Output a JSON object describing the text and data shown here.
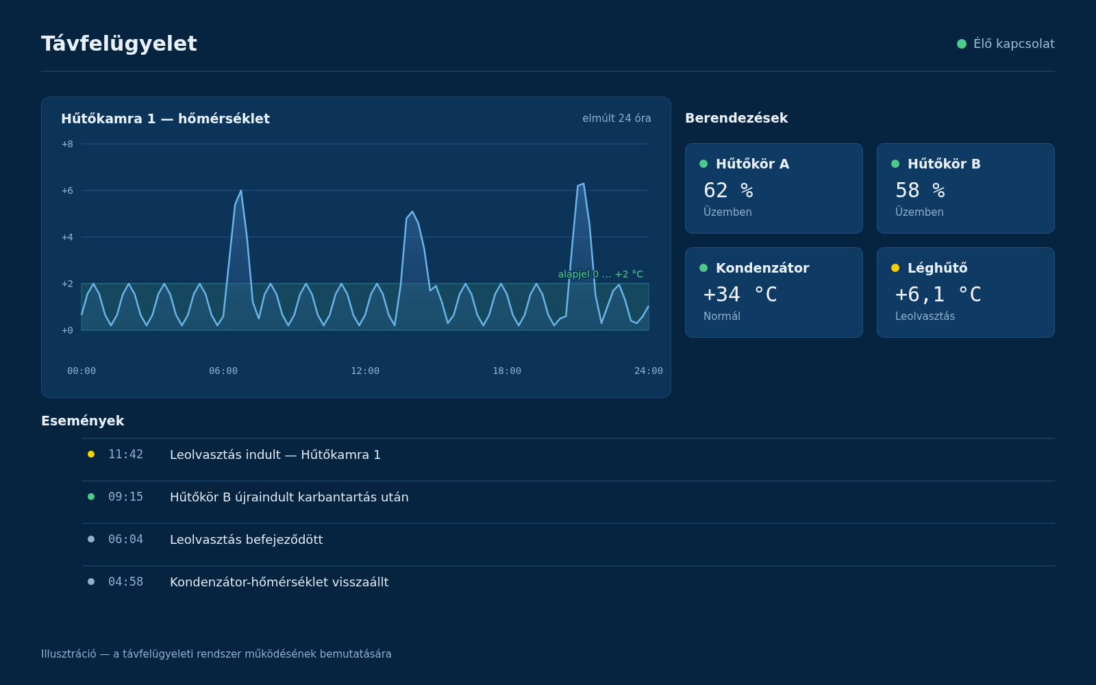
{
  "header": {
    "title": "Távfelügyelet",
    "status": {
      "label": "Élő kapcsolat",
      "color": "#4fc98a"
    }
  },
  "chart_panel": {
    "title": "Hűtőkamra 1 — hőmérséklet",
    "range": "elmúlt 24 óra",
    "chart_data": {
      "type": "area",
      "grid": true,
      "xlim": [
        0,
        24
      ],
      "ylim": [
        0,
        8
      ],
      "x": [
        0,
        0.25,
        0.5,
        0.75,
        1,
        1.25,
        1.5,
        1.75,
        2,
        2.25,
        2.5,
        2.75,
        3,
        3.25,
        3.5,
        3.75,
        4,
        4.25,
        4.5,
        4.75,
        5,
        5.25,
        5.5,
        5.75,
        6,
        6.25,
        6.5,
        6.75,
        7,
        7.25,
        7.5,
        7.75,
        8,
        8.25,
        8.5,
        8.75,
        9,
        9.25,
        9.5,
        9.75,
        10,
        10.25,
        10.5,
        10.75,
        11,
        11.25,
        11.5,
        11.75,
        12,
        12.25,
        12.5,
        12.75,
        13,
        13.25,
        13.5,
        13.75,
        14,
        14.25,
        14.5,
        14.75,
        15,
        15.25,
        15.5,
        15.75,
        16,
        16.25,
        16.5,
        16.75,
        17,
        17.25,
        17.5,
        17.75,
        18,
        18.25,
        18.5,
        18.75,
        19,
        19.25,
        19.5,
        19.75,
        20,
        20.25,
        20.5,
        20.75,
        21,
        21.25,
        21.5,
        21.75,
        22,
        22.25,
        22.5,
        22.75,
        23,
        23.25,
        23.5,
        23.75,
        24
      ],
      "xticks": [
        {
          "value": 0,
          "label": "00:00"
        },
        {
          "value": 6,
          "label": "06:00"
        },
        {
          "value": 12,
          "label": "12:00"
        },
        {
          "value": 18,
          "label": "18:00"
        },
        {
          "value": 24,
          "label": "24:00"
        }
      ],
      "yticks": [
        {
          "value": 0,
          "label": "+0"
        },
        {
          "value": 2,
          "label": "+2"
        },
        {
          "value": 4,
          "label": "+4"
        },
        {
          "value": 6,
          "label": "+6"
        },
        {
          "value": 8,
          "label": "+8"
        }
      ],
      "series": [
        {
          "color": "#6ab4e8",
          "values": [
            0.65,
            1.55,
            2.0,
            1.55,
            0.65,
            0.2,
            0.65,
            1.55,
            2.0,
            1.55,
            0.65,
            0.2,
            0.65,
            1.55,
            2.0,
            1.55,
            0.65,
            0.2,
            0.65,
            1.55,
            2.0,
            1.55,
            0.65,
            0.2,
            0.6,
            3.0,
            5.4,
            6.0,
            4.0,
            1.2,
            0.5,
            1.55,
            2.0,
            1.55,
            0.65,
            0.2,
            0.65,
            1.55,
            2.0,
            1.55,
            0.65,
            0.2,
            0.65,
            1.55,
            2.0,
            1.55,
            0.65,
            0.2,
            0.65,
            1.55,
            2.0,
            1.55,
            0.65,
            0.2,
            1.9,
            4.8,
            5.1,
            4.6,
            3.5,
            1.7,
            1.9,
            1.2,
            0.3,
            0.65,
            1.55,
            2.0,
            1.55,
            0.65,
            0.2,
            0.65,
            1.55,
            2.0,
            1.55,
            0.65,
            0.2,
            0.65,
            1.55,
            2.0,
            1.55,
            0.65,
            0.2,
            0.5,
            0.6,
            3.5,
            6.2,
            6.3,
            4.5,
            1.5,
            0.3,
            1.0,
            1.7,
            1.95,
            1.3,
            0.4,
            0.3,
            0.6,
            1.05
          ]
        }
      ],
      "bands": [
        {
          "axis": "y",
          "from": 0,
          "to": 2,
          "label": "alapjel 0 … +2 °C",
          "color": "#4fc98a"
        }
      ]
    }
  },
  "devices": {
    "title": "Berendezések",
    "items": [
      {
        "name": "Hűtőkör A",
        "value": "62 %",
        "state": "Üzemben",
        "color": "#4fc98a"
      },
      {
        "name": "Hűtőkör B",
        "value": "58 %",
        "state": "Üzemben",
        "color": "#4fc98a"
      },
      {
        "name": "Kondenzátor",
        "value": "+34 °C",
        "state": "Normál",
        "color": "#4fc98a"
      },
      {
        "name": "Léghűtő",
        "value": "+6,1 °C",
        "state": "Leolvasztás",
        "color": "#f5d000"
      }
    ]
  },
  "events": {
    "title": "Események",
    "items": [
      {
        "time": "11:42",
        "text": "Leolvasztás indult — Hűtőkamra 1",
        "color": "#f5d000"
      },
      {
        "time": "09:15",
        "text": "Hűtőkör B újraindult karbantartás után",
        "color": "#4fc98a"
      },
      {
        "time": "06:04",
        "text": "Leolvasztás befejeződött",
        "color": "#8fb0cc"
      },
      {
        "time": "04:58",
        "text": "Kondenzátor-hőmérséklet visszaállt",
        "color": "#8fb0cc"
      }
    ]
  },
  "footer": "Illusztráció — a távfelügyeleti rendszer működésének bemutatására"
}
